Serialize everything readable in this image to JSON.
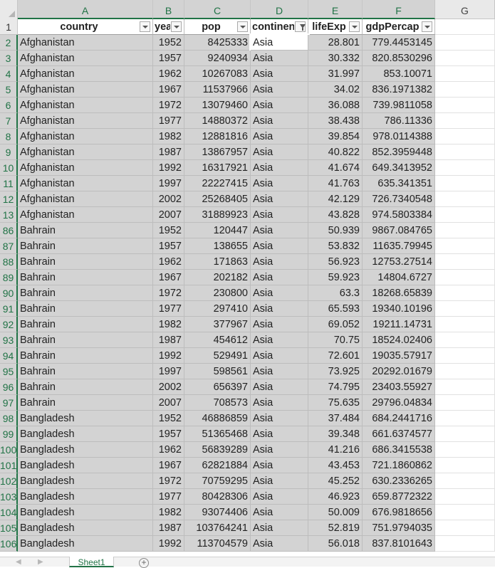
{
  "columns": [
    "A",
    "B",
    "C",
    "D",
    "E",
    "F",
    "G"
  ],
  "header": {
    "row_number": "1",
    "labels": [
      "country",
      "year",
      "pop",
      "continent",
      "lifeExp",
      "gdpPercap"
    ],
    "filtered_column_index": 3
  },
  "rows": [
    {
      "n": "2",
      "country": "Afghanistan",
      "year": "1952",
      "pop": "8425333",
      "continent": "Asia",
      "lifeExp": "28.801",
      "gdp": "779.4453145"
    },
    {
      "n": "3",
      "country": "Afghanistan",
      "year": "1957",
      "pop": "9240934",
      "continent": "Asia",
      "lifeExp": "30.332",
      "gdp": "820.8530296"
    },
    {
      "n": "4",
      "country": "Afghanistan",
      "year": "1962",
      "pop": "10267083",
      "continent": "Asia",
      "lifeExp": "31.997",
      "gdp": "853.10071"
    },
    {
      "n": "5",
      "country": "Afghanistan",
      "year": "1967",
      "pop": "11537966",
      "continent": "Asia",
      "lifeExp": "34.02",
      "gdp": "836.1971382"
    },
    {
      "n": "6",
      "country": "Afghanistan",
      "year": "1972",
      "pop": "13079460",
      "continent": "Asia",
      "lifeExp": "36.088",
      "gdp": "739.9811058"
    },
    {
      "n": "7",
      "country": "Afghanistan",
      "year": "1977",
      "pop": "14880372",
      "continent": "Asia",
      "lifeExp": "38.438",
      "gdp": "786.11336"
    },
    {
      "n": "8",
      "country": "Afghanistan",
      "year": "1982",
      "pop": "12881816",
      "continent": "Asia",
      "lifeExp": "39.854",
      "gdp": "978.0114388"
    },
    {
      "n": "9",
      "country": "Afghanistan",
      "year": "1987",
      "pop": "13867957",
      "continent": "Asia",
      "lifeExp": "40.822",
      "gdp": "852.3959448"
    },
    {
      "n": "10",
      "country": "Afghanistan",
      "year": "1992",
      "pop": "16317921",
      "continent": "Asia",
      "lifeExp": "41.674",
      "gdp": "649.3413952"
    },
    {
      "n": "11",
      "country": "Afghanistan",
      "year": "1997",
      "pop": "22227415",
      "continent": "Asia",
      "lifeExp": "41.763",
      "gdp": "635.341351"
    },
    {
      "n": "12",
      "country": "Afghanistan",
      "year": "2002",
      "pop": "25268405",
      "continent": "Asia",
      "lifeExp": "42.129",
      "gdp": "726.7340548"
    },
    {
      "n": "13",
      "country": "Afghanistan",
      "year": "2007",
      "pop": "31889923",
      "continent": "Asia",
      "lifeExp": "43.828",
      "gdp": "974.5803384"
    },
    {
      "n": "86",
      "country": "Bahrain",
      "year": "1952",
      "pop": "120447",
      "continent": "Asia",
      "lifeExp": "50.939",
      "gdp": "9867.084765"
    },
    {
      "n": "87",
      "country": "Bahrain",
      "year": "1957",
      "pop": "138655",
      "continent": "Asia",
      "lifeExp": "53.832",
      "gdp": "11635.79945"
    },
    {
      "n": "88",
      "country": "Bahrain",
      "year": "1962",
      "pop": "171863",
      "continent": "Asia",
      "lifeExp": "56.923",
      "gdp": "12753.27514"
    },
    {
      "n": "89",
      "country": "Bahrain",
      "year": "1967",
      "pop": "202182",
      "continent": "Asia",
      "lifeExp": "59.923",
      "gdp": "14804.6727"
    },
    {
      "n": "90",
      "country": "Bahrain",
      "year": "1972",
      "pop": "230800",
      "continent": "Asia",
      "lifeExp": "63.3",
      "gdp": "18268.65839"
    },
    {
      "n": "91",
      "country": "Bahrain",
      "year": "1977",
      "pop": "297410",
      "continent": "Asia",
      "lifeExp": "65.593",
      "gdp": "19340.10196"
    },
    {
      "n": "92",
      "country": "Bahrain",
      "year": "1982",
      "pop": "377967",
      "continent": "Asia",
      "lifeExp": "69.052",
      "gdp": "19211.14731"
    },
    {
      "n": "93",
      "country": "Bahrain",
      "year": "1987",
      "pop": "454612",
      "continent": "Asia",
      "lifeExp": "70.75",
      "gdp": "18524.02406"
    },
    {
      "n": "94",
      "country": "Bahrain",
      "year": "1992",
      "pop": "529491",
      "continent": "Asia",
      "lifeExp": "72.601",
      "gdp": "19035.57917"
    },
    {
      "n": "95",
      "country": "Bahrain",
      "year": "1997",
      "pop": "598561",
      "continent": "Asia",
      "lifeExp": "73.925",
      "gdp": "20292.01679"
    },
    {
      "n": "96",
      "country": "Bahrain",
      "year": "2002",
      "pop": "656397",
      "continent": "Asia",
      "lifeExp": "74.795",
      "gdp": "23403.55927"
    },
    {
      "n": "97",
      "country": "Bahrain",
      "year": "2007",
      "pop": "708573",
      "continent": "Asia",
      "lifeExp": "75.635",
      "gdp": "29796.04834"
    },
    {
      "n": "98",
      "country": "Bangladesh",
      "year": "1952",
      "pop": "46886859",
      "continent": "Asia",
      "lifeExp": "37.484",
      "gdp": "684.2441716"
    },
    {
      "n": "99",
      "country": "Bangladesh",
      "year": "1957",
      "pop": "51365468",
      "continent": "Asia",
      "lifeExp": "39.348",
      "gdp": "661.6374577"
    },
    {
      "n": "100",
      "country": "Bangladesh",
      "year": "1962",
      "pop": "56839289",
      "continent": "Asia",
      "lifeExp": "41.216",
      "gdp": "686.3415538"
    },
    {
      "n": "101",
      "country": "Bangladesh",
      "year": "1967",
      "pop": "62821884",
      "continent": "Asia",
      "lifeExp": "43.453",
      "gdp": "721.1860862"
    },
    {
      "n": "102",
      "country": "Bangladesh",
      "year": "1972",
      "pop": "70759295",
      "continent": "Asia",
      "lifeExp": "45.252",
      "gdp": "630.2336265"
    },
    {
      "n": "103",
      "country": "Bangladesh",
      "year": "1977",
      "pop": "80428306",
      "continent": "Asia",
      "lifeExp": "46.923",
      "gdp": "659.8772322"
    },
    {
      "n": "104",
      "country": "Bangladesh",
      "year": "1982",
      "pop": "93074406",
      "continent": "Asia",
      "lifeExp": "50.009",
      "gdp": "676.9818656"
    },
    {
      "n": "105",
      "country": "Bangladesh",
      "year": "1987",
      "pop": "103764241",
      "continent": "Asia",
      "lifeExp": "52.819",
      "gdp": "751.9794035"
    },
    {
      "n": "106",
      "country": "Bangladesh",
      "year": "1992",
      "pop": "113704579",
      "continent": "Asia",
      "lifeExp": "56.018",
      "gdp": "837.8101643"
    }
  ],
  "sheet_tabs": [
    {
      "label": "Sheet1",
      "active": true
    }
  ],
  "colors": {
    "accent": "#217346",
    "selected_fill": "#d3d3d3",
    "header_fill": "#e9e9e9"
  },
  "icons": {
    "filter": "filter-dropdown-icon",
    "filter_active": "filter-funnel-icon",
    "add_sheet": "plus-circle-icon",
    "select_all": "select-all-triangle-icon"
  }
}
